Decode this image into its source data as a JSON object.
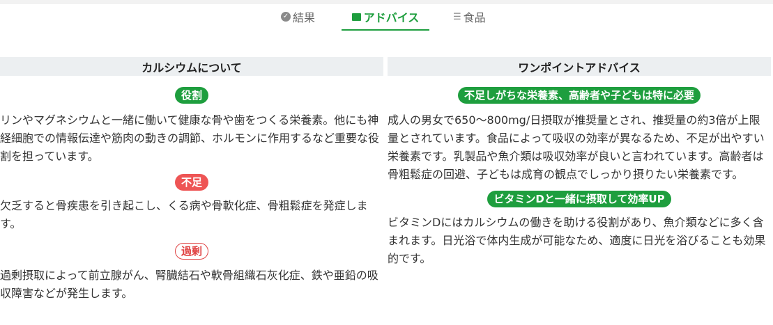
{
  "tabs": {
    "result": {
      "label": "結果",
      "icon": "check-circle-icon"
    },
    "advice": {
      "label": "アドバイス",
      "icon": "flag-icon"
    },
    "food": {
      "label": "食品",
      "icon": "list-icon"
    }
  },
  "colors": {
    "accent_green": "#1e9e3e",
    "alert_red": "#ee5555",
    "header_bg": "#eceff1"
  },
  "left": {
    "header": "カルシウムについて",
    "sections": [
      {
        "tag": "役割",
        "text": "リンやマグネシウムと一緒に働いて健康な骨や歯をつくる栄養素。他にも神経細胞での情報伝達や筋肉の動きの調節、ホルモンに作用するなど重要な役割を担っています。"
      },
      {
        "tag": "不足",
        "text": "欠乏すると骨疾患を引き起こし、くる病や骨軟化症、骨粗鬆症を発症します。"
      },
      {
        "tag": "過剰",
        "text": "過剰摂取によって前立腺がん、腎臓結石や軟骨組織石灰化症、鉄や亜鉛の吸収障害などが発生します。"
      }
    ]
  },
  "right": {
    "header": "ワンポイントアドバイス",
    "sections": [
      {
        "tag": "不足しがちな栄養素、高齢者や子どもは特に必要",
        "text": "成人の男女で650～800mg/日摂取が推奨量とされ、推奨量の約3倍が上限量とされています。食品によって吸収の効率が異なるため、不足が出やすい栄養素です。乳製品や魚介類は吸収効率が良いと言われています。高齢者は骨粗鬆症の回避、子どもは成育の観点でしっかり摂りたい栄養素です。"
      },
      {
        "tag": "ビタミンDと一緒に摂取して効率UP",
        "text": "ビタミンDにはカルシウムの働きを助ける役割があり、魚介類などに多く含まれます。日光浴で体内生成が可能なため、適度に日光を浴びることも効果的です。"
      }
    ]
  }
}
